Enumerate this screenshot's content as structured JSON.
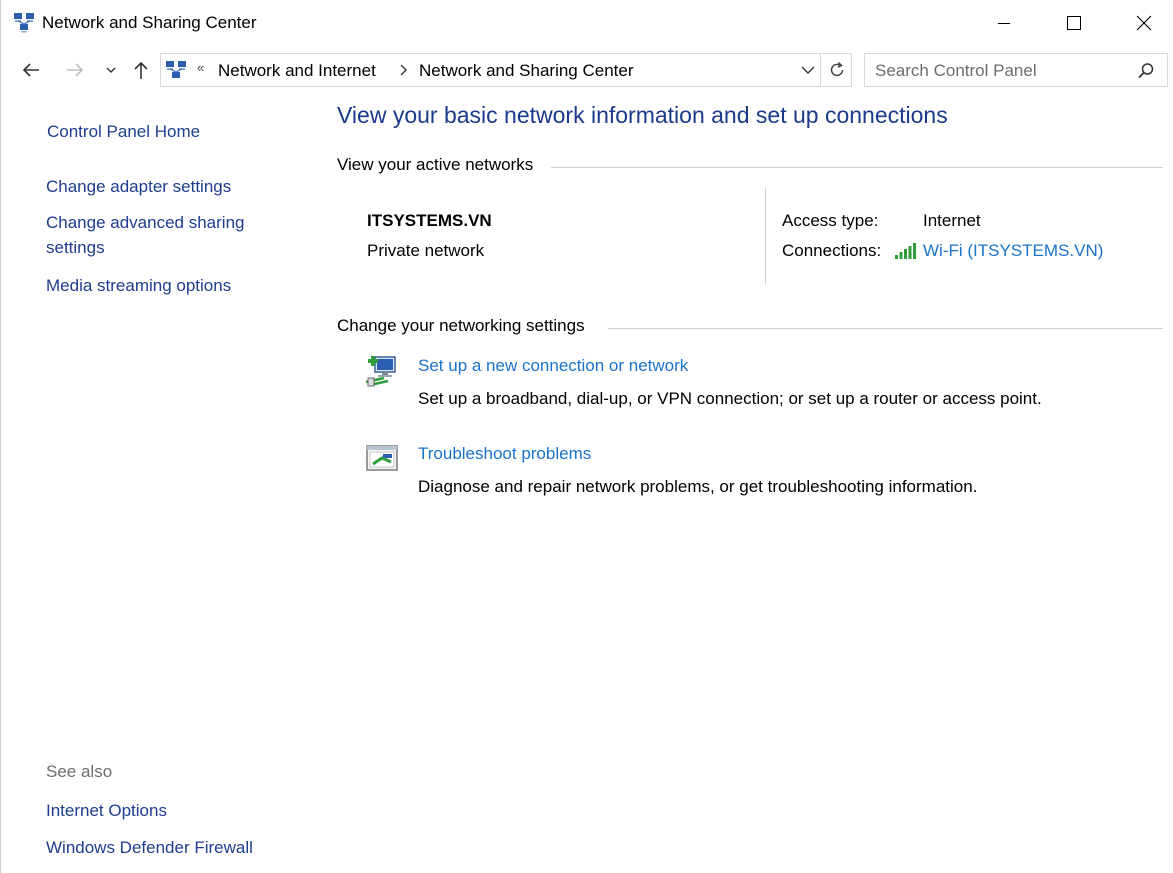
{
  "window": {
    "title": "Network and Sharing Center"
  },
  "navigation": {
    "breadcrumb_overflow": "«",
    "breadcrumbs": [
      "Network and Internet",
      "Network and Sharing Center"
    ],
    "search_placeholder": "Search Control Panel"
  },
  "sidebar": {
    "home": "Control Panel Home",
    "links": [
      "Change adapter settings",
      "Change advanced sharing settings",
      "Media streaming options"
    ],
    "see_also_label": "See also",
    "see_also": [
      "Internet Options",
      "Windows Defender Firewall"
    ]
  },
  "main": {
    "title": "View your basic network information and set up connections",
    "active_networks": {
      "heading": "View your active networks",
      "network_name": "ITSYSTEMS.VN",
      "network_type": "Private network",
      "access_type_label": "Access type:",
      "access_type_value": "Internet",
      "connections_label": "Connections:",
      "connection_link": "Wi-Fi (ITSYSTEMS.VN)"
    },
    "change_settings": {
      "heading": "Change your networking settings",
      "tasks": [
        {
          "title": "Set up a new connection or network",
          "description": "Set up a broadband, dial-up, or VPN connection; or set up a router or access point."
        },
        {
          "title": "Troubleshoot problems",
          "description": "Diagnose and repair network problems, or get troubleshooting information."
        }
      ]
    }
  },
  "colors": {
    "title_blue": "#1a3a8c",
    "link_blue": "#1a73c9",
    "sidebar_link": "#1e3d8f",
    "muted_text": "#6d6d6d",
    "signal_green": "#2e9e3a"
  },
  "icons": {
    "app": "network-center-icon",
    "wifi": "wifi-signal-icon",
    "new_connection": "new-connection-icon",
    "troubleshoot": "troubleshoot-icon"
  }
}
